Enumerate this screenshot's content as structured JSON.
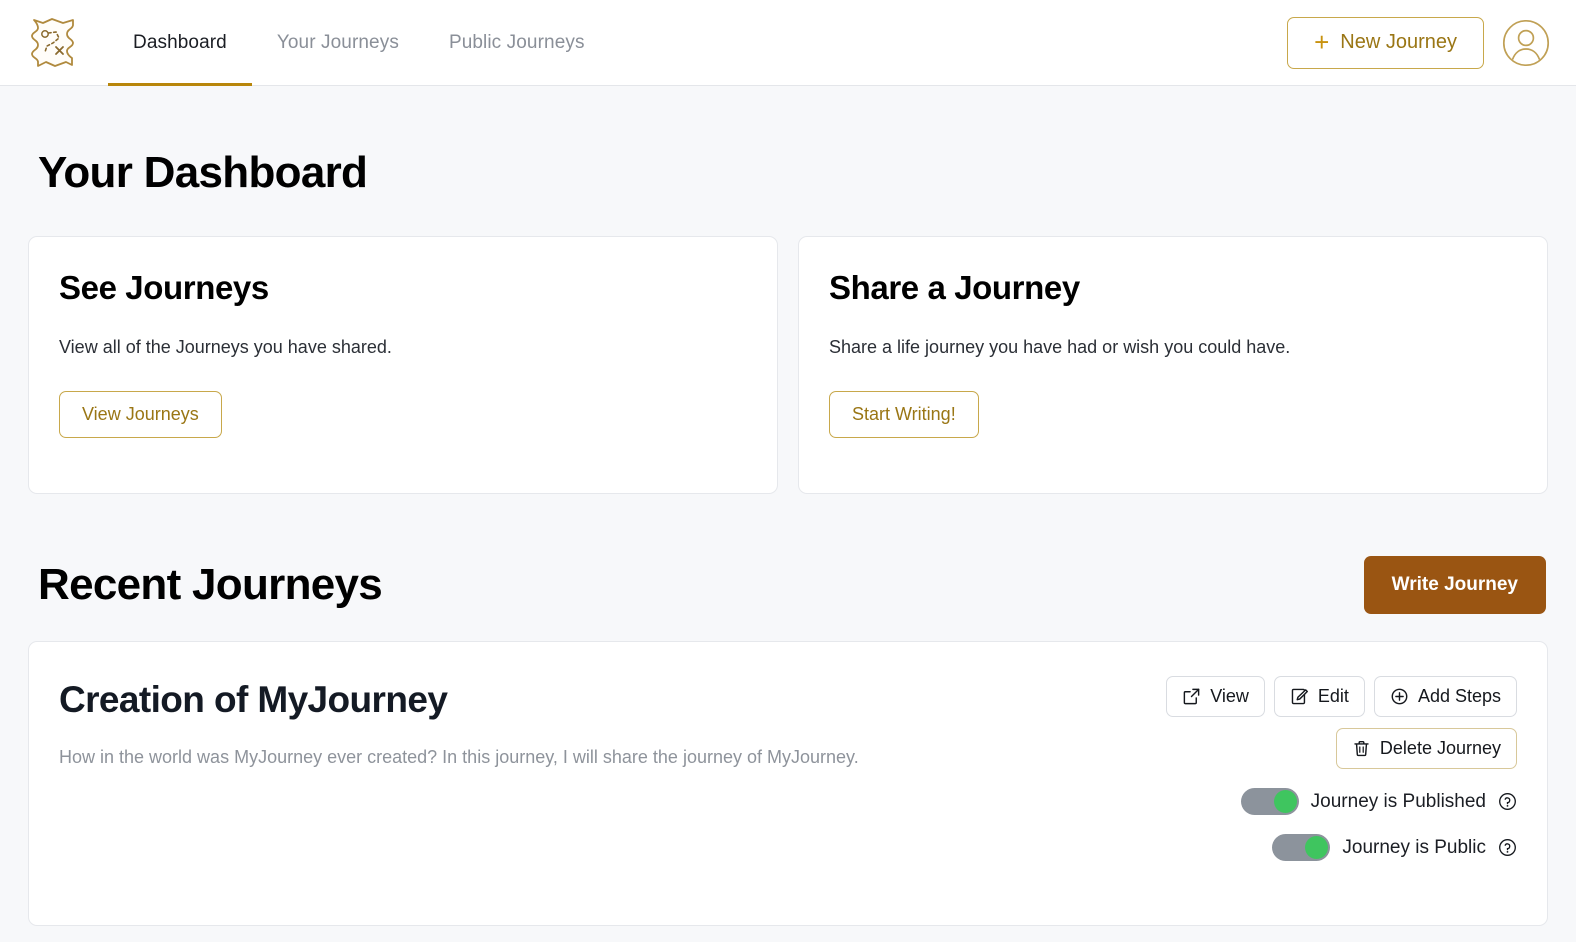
{
  "nav": {
    "logo_name": "treasure-map-logo",
    "links": [
      {
        "label": "Dashboard",
        "active": true
      },
      {
        "label": "Your Journeys",
        "active": false
      },
      {
        "label": "Public Journeys",
        "active": false
      }
    ],
    "new_journey_label": "New Journey",
    "new_journey_icon": "plus-icon",
    "avatar_icon": "user-avatar-icon"
  },
  "colors": {
    "page_background": "#f7f8fa",
    "gold_accent": "#b8860b",
    "gold_border": "#c8a84b",
    "gold_text": "#9a7615",
    "brown_button": "#9a5512",
    "toggle_track": "#8c939c",
    "toggle_knob_on": "#3fc55f",
    "card_border": "#e6e8ec",
    "muted_text": "#8e939b"
  },
  "main": {
    "page_title": "Your Dashboard",
    "cards": [
      {
        "title": "See Journeys",
        "description": "View all of the Journeys you have shared.",
        "button_label": "View Journeys"
      },
      {
        "title": "Share a Journey",
        "description": "Share a life journey you have had or wish you could have.",
        "button_label": "Start Writing!"
      }
    ],
    "recent": {
      "title": "Recent Journeys",
      "write_button_label": "Write Journey",
      "journeys": [
        {
          "title": "Creation of MyJourney",
          "description": "How in the world was MyJourney ever created? In this journey, I will share the journey of MyJourney.",
          "actions": [
            {
              "label": "View",
              "icon": "external-link-icon"
            },
            {
              "label": "Edit",
              "icon": "pencil-square-icon"
            },
            {
              "label": "Add Steps",
              "icon": "plus-circle-icon"
            }
          ],
          "delete_action": {
            "label": "Delete Journey",
            "icon": "trash-icon"
          },
          "toggles": [
            {
              "label": "Journey is Published",
              "on": true,
              "help_icon": "question-circle-icon"
            },
            {
              "label": "Journey is Public",
              "on": true,
              "help_icon": "question-circle-icon"
            }
          ]
        }
      ]
    }
  },
  "watermark": {
    "text": ""
  }
}
